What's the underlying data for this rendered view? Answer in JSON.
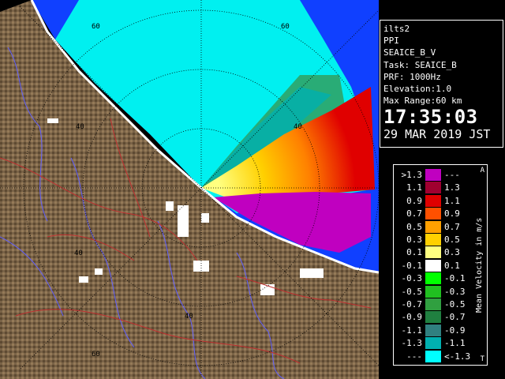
{
  "header": {
    "lines": [
      "ilts2",
      "PPI",
      "SEAICE_B_V",
      "Task: SEAICE_B",
      "PRF: 1000Hz",
      "Elevation:1.0",
      "Max Range:60 km"
    ],
    "time": "17:35:03",
    "date": "29 MAR 2019 JST"
  },
  "range_labels": [
    "60",
    "60",
    "40",
    "40",
    "40",
    "40",
    "60"
  ],
  "legend": {
    "title": "Mean Velocity in m/s",
    "cap_top": "A",
    "cap_bottom": "T",
    "rows": [
      {
        "lo": ">1.3",
        "hi": "---",
        "color": "#c000c0"
      },
      {
        "lo": "1.1",
        "hi": "1.3",
        "color": "#a00030"
      },
      {
        "lo": "0.9",
        "hi": "1.1",
        "color": "#e00000"
      },
      {
        "lo": "0.7",
        "hi": "0.9",
        "color": "#ff5000"
      },
      {
        "lo": "0.5",
        "hi": "0.7",
        "color": "#ffa000"
      },
      {
        "lo": "0.3",
        "hi": "0.5",
        "color": "#ffd000"
      },
      {
        "lo": "0.1",
        "hi": "0.3",
        "color": "#ffff80"
      },
      {
        "lo": "-0.1",
        "hi": "0.1",
        "color": "#ffffff"
      },
      {
        "lo": "-0.3",
        "hi": "-0.1",
        "color": "#00ff00"
      },
      {
        "lo": "-0.5",
        "hi": "-0.3",
        "color": "#20c020"
      },
      {
        "lo": "-0.7",
        "hi": "-0.5",
        "color": "#30a040"
      },
      {
        "lo": "-0.9",
        "hi": "-0.7",
        "color": "#208040"
      },
      {
        "lo": "-1.1",
        "hi": "-0.9",
        "color": "#308080"
      },
      {
        "lo": "-1.3",
        "hi": "-1.1",
        "color": "#00b0b0"
      },
      {
        "lo": "---",
        "hi": "<-1.3",
        "color": "#00ffff"
      }
    ]
  },
  "colors": {
    "land": "#7a6347",
    "sea_radar": "#00f0f0",
    "sea_blue": "#1040ff",
    "coast": "#ffffff",
    "roads": "#c03030",
    "rivers": "#6060ff"
  }
}
